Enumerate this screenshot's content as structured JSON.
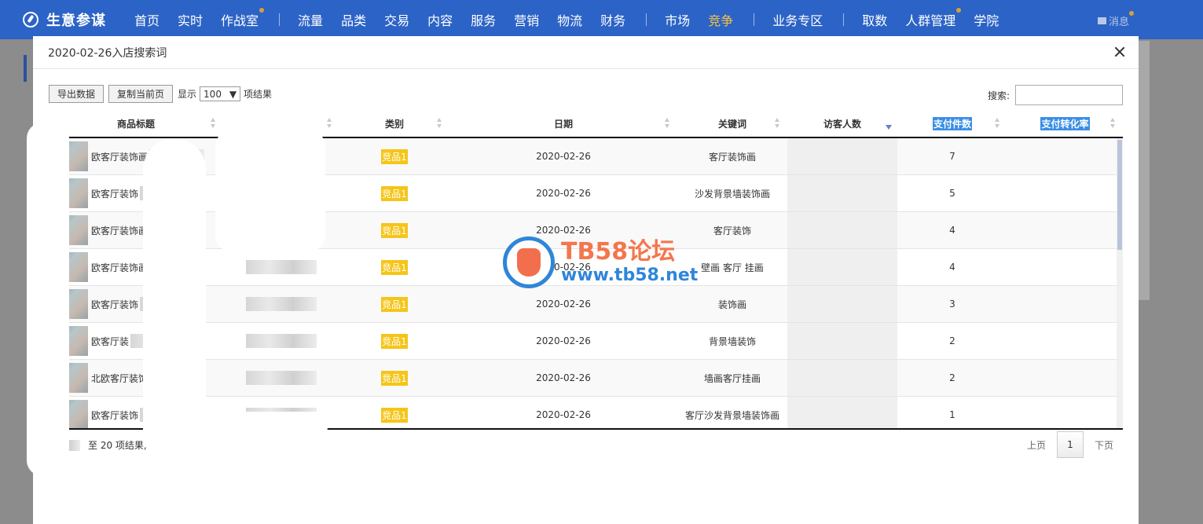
{
  "nav": {
    "logo_text": "生意参谋",
    "items_a": [
      "首页",
      "实时",
      "作战室"
    ],
    "items_b": [
      "流量",
      "品类",
      "交易",
      "内容",
      "服务",
      "营销",
      "物流",
      "财务"
    ],
    "items_c": [
      "市场",
      "竞争"
    ],
    "items_d": [
      "业务专区"
    ],
    "items_e": [
      "取数",
      "人群管理",
      "学院"
    ],
    "active": "竞争",
    "message_label": "消息"
  },
  "modal": {
    "title": "2020-02-26入店搜索词",
    "export_button": "导出数据",
    "copy_button": "复制当前页",
    "show_label": "显示",
    "page_size": "100",
    "results_label": "项结果",
    "search_label": "搜索:",
    "search_value": ""
  },
  "table": {
    "columns": [
      "商品标题",
      "",
      "类别",
      "日期",
      "关键词",
      "访客人数",
      "支付件数",
      "支付转化率"
    ],
    "rows": [
      {
        "title": "欧客厅装饰画",
        "category": "竞品1",
        "date": "2020-02-26",
        "keyword": "客厅装饰画",
        "paid_items": "7",
        "conversion": ""
      },
      {
        "title": "欧客厅装饰",
        "category": "竞品1",
        "date": "2020-02-26",
        "keyword": "沙发背景墙装饰画",
        "paid_items": "5",
        "conversion": ""
      },
      {
        "title": "欧客厅装饰画",
        "category": "竞品1",
        "date": "2020-02-26",
        "keyword": "客厅装饰",
        "paid_items": "4",
        "conversion": ""
      },
      {
        "title": "欧客厅装饰画",
        "category": "竞品1",
        "date": "2020-02-26",
        "keyword": "壁画 客厅 挂画",
        "paid_items": "4",
        "conversion": ""
      },
      {
        "title": "欧客厅装饰",
        "category": "竞品1",
        "date": "2020-02-26",
        "keyword": "装饰画",
        "paid_items": "3",
        "conversion": ""
      },
      {
        "title": "欧客厅装",
        "category": "竞品1",
        "date": "2020-02-26",
        "keyword": "背景墙装饰",
        "paid_items": "2",
        "conversion": ""
      },
      {
        "title": "北欧客厅装饰",
        "category": "竞品1",
        "date": "2020-02-26",
        "keyword": "墙画客厅挂画",
        "paid_items": "2",
        "conversion": ""
      },
      {
        "title": "欧客厅装饰",
        "category": "竞品1",
        "date": "2020-02-26",
        "keyword": "客厅沙发背景墙装饰画",
        "paid_items": "1",
        "conversion": ""
      }
    ]
  },
  "footer": {
    "info_text": "至 20 项结果,",
    "prev": "上页",
    "current_page": "1",
    "next": "下页"
  },
  "watermark": {
    "line1": "TB58论坛",
    "line2": "www.tb58.net"
  },
  "colors": {
    "nav_bg": "#2c63c6",
    "active": "#f5c242",
    "tag": "#f5c518",
    "highlight": "#3a8ee6"
  }
}
